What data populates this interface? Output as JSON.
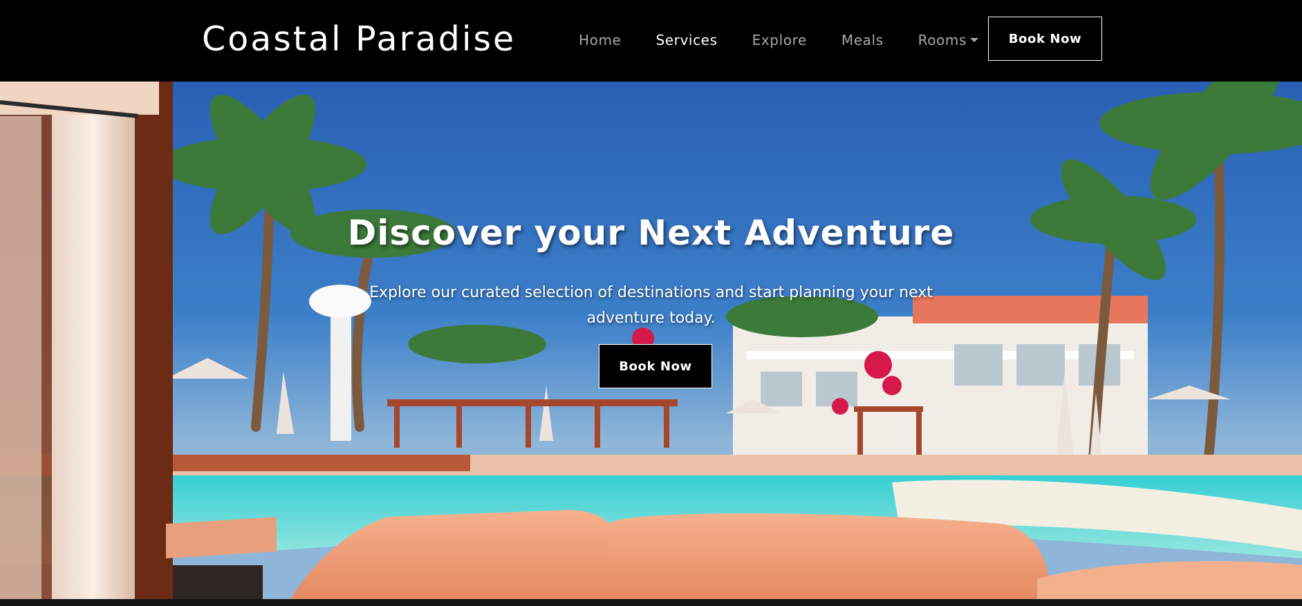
{
  "brand": {
    "name": "Coastal Paradise"
  },
  "nav": {
    "items": [
      {
        "label": "Home",
        "active": false
      },
      {
        "label": "Services",
        "active": true
      },
      {
        "label": "Explore",
        "active": false
      },
      {
        "label": "Meals",
        "active": false
      },
      {
        "label": "Rooms",
        "active": false,
        "dropdown": true
      }
    ],
    "cta_label": "Book Now"
  },
  "hero": {
    "title": "Discover your Next Adventure",
    "subtitle": "Explore our curated selection of destinations and start planning your next adventure today.",
    "cta_label": "Book Now",
    "image_alt": ""
  },
  "colors": {
    "navbar_bg": "#000000",
    "text_primary": "#ffffff",
    "nav_inactive": "#a8a8a8",
    "sky": "#2f6fbf",
    "pool": "#3fd6d6",
    "sunbed": "#f2a27c"
  },
  "icons": {
    "rooms_dropdown": "caret-down-icon"
  }
}
